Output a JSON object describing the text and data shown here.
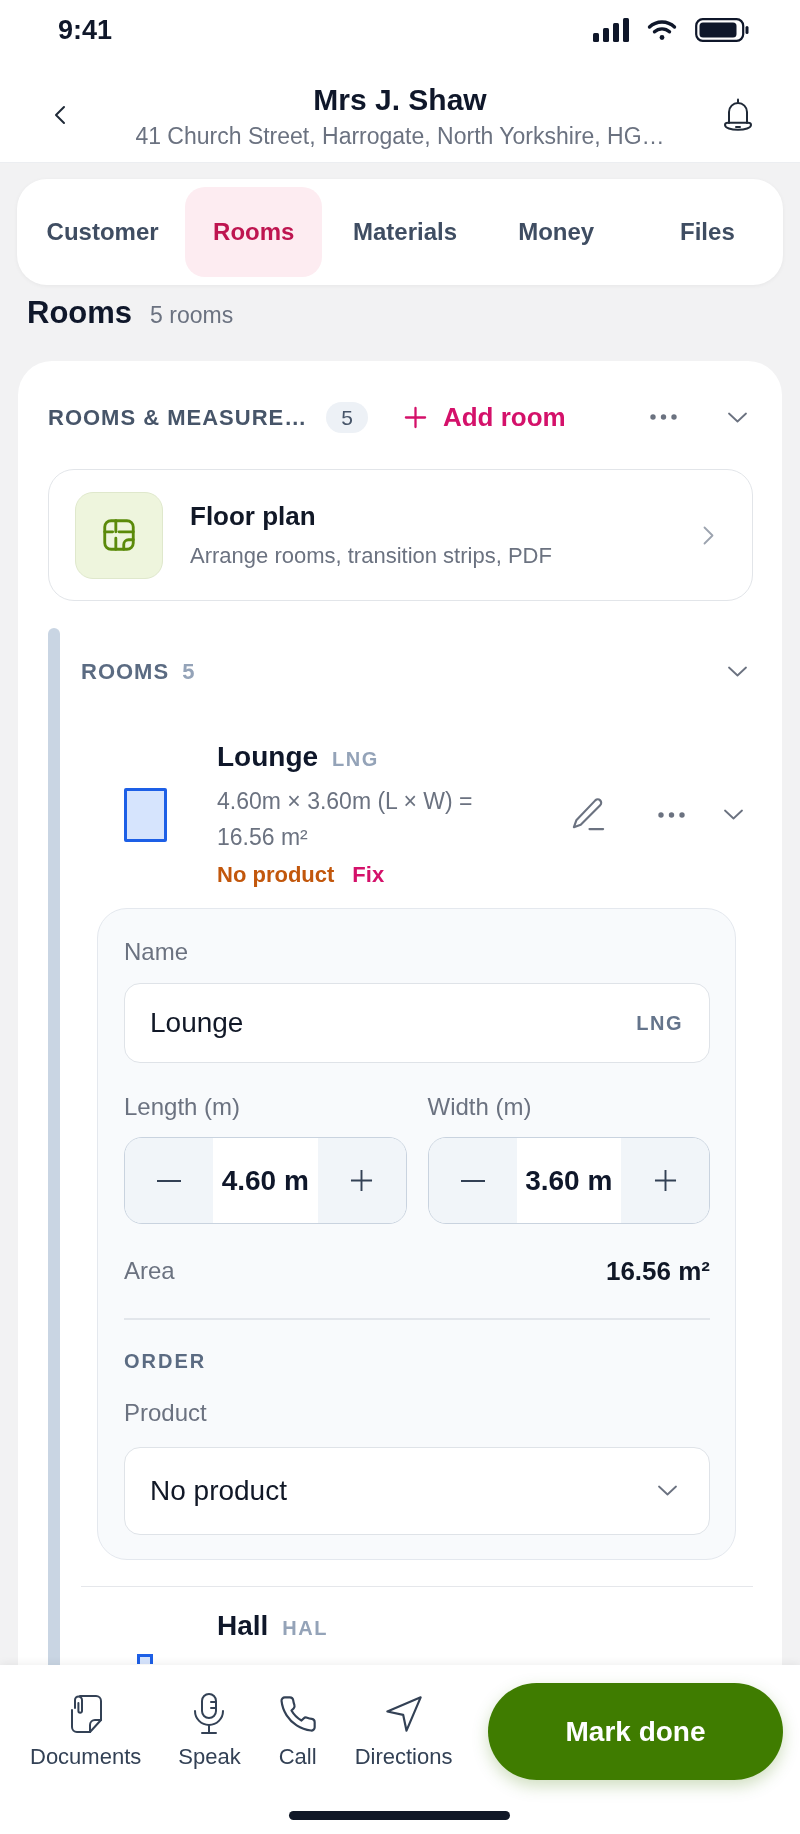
{
  "status_bar": {
    "time": "9:41"
  },
  "header": {
    "title": "Mrs J. Shaw",
    "subtitle": "41 Church Street, Harrogate, North Yorkshire, HG…"
  },
  "tabs": [
    {
      "label": "Customer",
      "selected": false
    },
    {
      "label": "Rooms",
      "selected": true
    },
    {
      "label": "Materials",
      "selected": false
    },
    {
      "label": "Money",
      "selected": false
    },
    {
      "label": "Files",
      "selected": false
    }
  ],
  "page_heading": {
    "title": "Rooms",
    "count": "5 rooms"
  },
  "section": {
    "title": "ROOMS & MEASURE…",
    "count": "5",
    "add_button": "Add room",
    "floor_plan": {
      "title": "Floor plan",
      "subtitle": "Arrange rooms, transition strips, PDF"
    },
    "rooms_group": {
      "label": "ROOMS",
      "count": "5"
    },
    "rooms": [
      {
        "name": "Lounge",
        "code": "LNG",
        "dimensions": "4.60m × 3.60m (L × W) = 16.56 m²",
        "status": "No product",
        "action": "Fix",
        "expanded": true,
        "details": {
          "name_label": "Name",
          "name_value": "Lounge",
          "name_code": "LNG",
          "length_label": "Length (m)",
          "length_value": "4.60 m",
          "width_label": "Width (m)",
          "width_value": "3.60 m",
          "area_label": "Area",
          "area_value": "16.56 m²",
          "order_heading": "ORDER",
          "product_label": "Product",
          "product_value": "No product"
        }
      },
      {
        "name": "Hall",
        "code": "HAL",
        "expanded": false
      }
    ]
  },
  "bottom_bar": {
    "actions": [
      {
        "kind": "documents",
        "label": "Documents"
      },
      {
        "kind": "speak",
        "label": "Speak"
      },
      {
        "kind": "call",
        "label": "Call"
      },
      {
        "kind": "directions",
        "label": "Directions"
      }
    ],
    "primary_button": "Mark done"
  }
}
